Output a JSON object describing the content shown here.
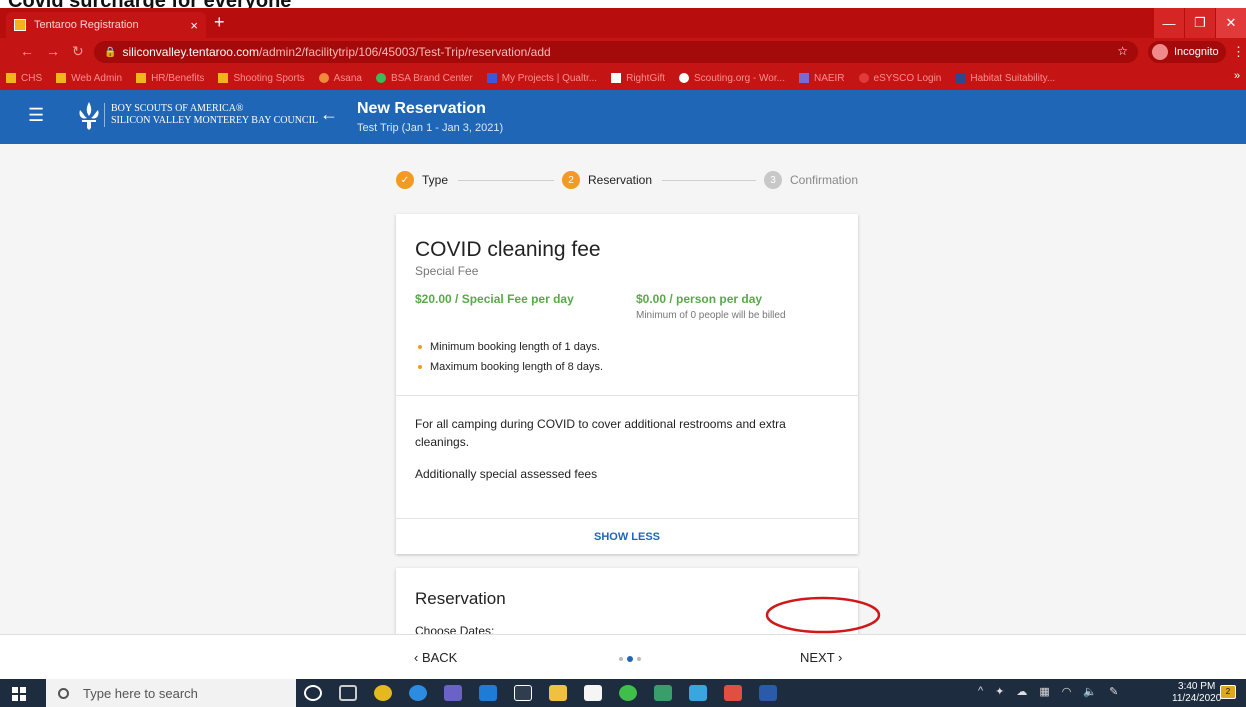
{
  "overlay_caption": "Covid surcharge for everyone",
  "browser": {
    "tab_title": "Tentaroo Registration",
    "tab_close": "×",
    "new_tab": "+",
    "url_host": "siliconvalley.tentaroo.com",
    "url_path": "/admin2/facilitytrip/106/45003/Test-Trip/reservation/add",
    "profile_label": "Incognito",
    "bookmarks": [
      "CHS",
      "Web Admin",
      "HR/Benefits",
      "Shooting Sports",
      "Asana",
      "BSA Brand Center",
      "My Projects | Qualtr...",
      "RightGift",
      "Scouting.org - Wor...",
      "NAEIR",
      "eSYSCO Login",
      "Habitat Suitability..."
    ]
  },
  "app_header": {
    "org_line1": "BOY SCOUTS OF AMERICA®",
    "org_line2": "SILICON VALLEY MONTEREY BAY COUNCIL",
    "title": "New Reservation",
    "subtitle": "Test Trip (Jan 1 - Jan 3, 2021)"
  },
  "stepper": {
    "steps": [
      {
        "number": "✓",
        "label": "Type"
      },
      {
        "number": "2",
        "label": "Reservation"
      },
      {
        "number": "3",
        "label": "Confirmation"
      }
    ]
  },
  "fee_card": {
    "title": "COVID cleaning fee",
    "subtitle": "Special Fee",
    "price_primary": "$20.00 / Special Fee per day",
    "price_secondary": "$0.00 / person per day",
    "price_note": "Minimum of 0 people will be billed",
    "rules": [
      "Minimum booking length of 1 days.",
      "Maximum booking length of 8 days."
    ],
    "description": "For all camping during COVID to cover additional restrooms and extra cleanings.",
    "extra_note": "Additionally special assessed fees",
    "toggle_label": "SHOW LESS"
  },
  "reservation_card": {
    "title": "Reservation",
    "choose_dates": "Choose Dates:"
  },
  "bottom_nav": {
    "back_label": "BACK",
    "next_label": "NEXT",
    "pages": 3,
    "active_page": 2
  },
  "taskbar": {
    "search_placeholder": "Type here to search",
    "time": "3:40 PM",
    "date": "11/24/2020",
    "notification_count": "2"
  }
}
